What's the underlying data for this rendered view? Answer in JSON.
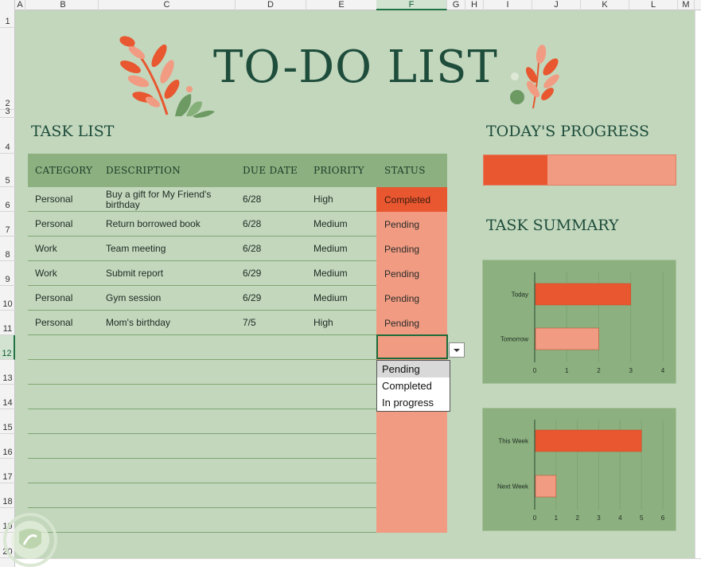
{
  "grid": {
    "columns": [
      "A",
      "B",
      "C",
      "D",
      "E",
      "F",
      "G",
      "H",
      "I",
      "J",
      "K",
      "L",
      "M"
    ],
    "rows": [
      "1",
      "2",
      "3",
      "4",
      "5",
      "6",
      "7",
      "8",
      "9",
      "10",
      "11",
      "12",
      "13",
      "14",
      "15",
      "16",
      "17",
      "18",
      "19",
      "20"
    ],
    "selected_column": "F",
    "selected_row": "12"
  },
  "title": "TO-DO LIST",
  "task_list": {
    "heading": "TASK LIST",
    "headers": {
      "category": "CATEGORY",
      "description": "DESCRIPTION",
      "due_date": "DUE DATE",
      "priority": "PRIORITY",
      "status": "STATUS"
    },
    "rows": [
      {
        "category": "Personal",
        "description": "Buy a gift for My Friend's birthday",
        "due_date": "6/28",
        "priority": "High",
        "status": "Completed"
      },
      {
        "category": "Personal",
        "description": "Return borrowed book",
        "due_date": "6/28",
        "priority": "Medium",
        "status": "Pending"
      },
      {
        "category": "Work",
        "description": "Team meeting",
        "due_date": "6/28",
        "priority": "Medium",
        "status": "Pending"
      },
      {
        "category": "Work",
        "description": "Submit report",
        "due_date": "6/29",
        "priority": "Medium",
        "status": "Pending"
      },
      {
        "category": "Personal",
        "description": "Gym session",
        "due_date": "6/29",
        "priority": "Medium",
        "status": "Pending"
      },
      {
        "category": "Personal",
        "description": "Mom's birthday",
        "due_date": "7/5",
        "priority": "High",
        "status": "Pending"
      }
    ],
    "empty_rows": 8
  },
  "status_dropdown": {
    "options": [
      "Pending",
      "Completed",
      "In progress"
    ],
    "highlighted": "Pending"
  },
  "progress": {
    "heading": "TODAY'S PROGRESS",
    "completed_fraction": 0.333
  },
  "summary": {
    "heading": "TASK SUMMARY"
  },
  "colors": {
    "background": "#c3d7bd",
    "header_green": "#8cb07f",
    "title_green": "#1e4d3b",
    "accent_dark": "#e8572f",
    "accent_light": "#f19c82"
  },
  "chart_data": [
    {
      "type": "bar",
      "orientation": "horizontal",
      "categories": [
        "Today",
        "Tomorrow"
      ],
      "series": [
        {
          "values": [
            3,
            2
          ]
        }
      ],
      "xlim": [
        0,
        4
      ],
      "ticks": [
        "0",
        "1",
        "2",
        "3",
        "4"
      ],
      "grid": true
    },
    {
      "type": "bar",
      "orientation": "horizontal",
      "categories": [
        "This Week",
        "Next Week"
      ],
      "series": [
        {
          "values": [
            5,
            1
          ]
        }
      ],
      "xlim": [
        0,
        6
      ],
      "ticks": [
        "0",
        "1",
        "2",
        "3",
        "4",
        "5",
        "6"
      ],
      "grid": true
    }
  ]
}
